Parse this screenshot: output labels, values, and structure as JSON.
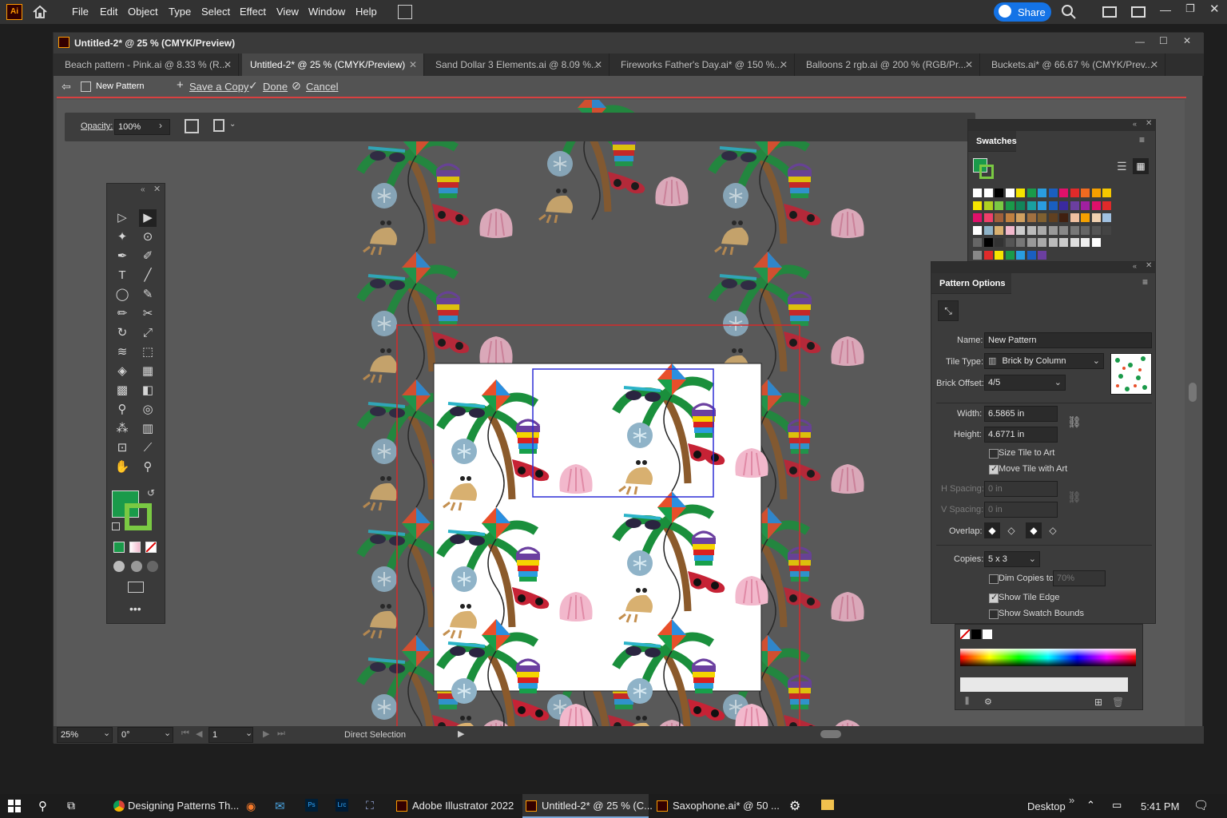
{
  "app": {
    "menu": [
      "File",
      "Edit",
      "Object",
      "Type",
      "Select",
      "Effect",
      "View",
      "Window",
      "Help"
    ],
    "share_label": "Share",
    "colors": {
      "accent": "#1473e6",
      "menubar": "#323232",
      "tile_edge": "#2f2fd6",
      "swatch_bounds": "#d42a2a"
    }
  },
  "document": {
    "title": "Untitled-2* @ 25 % (CMYK/Preview)",
    "tabs": [
      {
        "label": "Beach pattern - Pink.ai @ 8.33 % (R..."
      },
      {
        "label": "Untitled-2* @ 25 % (CMYK/Preview)",
        "active": true
      },
      {
        "label": "Sand Dollar 3 Elements.ai @ 8.09 %..."
      },
      {
        "label": "Fireworks Father's Day.ai* @ 150 %..."
      },
      {
        "label": "Balloons 2 rgb.ai @ 200 % (RGB/Pr..."
      },
      {
        "label": "Buckets.ai* @ 66.67 % (CMYK/Prev..."
      }
    ]
  },
  "pattern_bar": {
    "name": "New Pattern",
    "save_copy": "Save a Copy",
    "done": "Done",
    "cancel": "Cancel"
  },
  "control_bar": {
    "opacity_label": "Opacity:",
    "opacity_value": "100%"
  },
  "status_bar": {
    "zoom": "25%",
    "rotation": "0°",
    "artboard": "1",
    "tool": "Direct Selection"
  },
  "swatches_panel": {
    "title": "Swatches"
  },
  "pattern_options": {
    "title": "Pattern Options",
    "name_label": "Name:",
    "name_value": "New Pattern",
    "tile_type_label": "Tile Type:",
    "tile_type_value": "Brick by Column",
    "brick_offset_label": "Brick Offset:",
    "brick_offset_value": "4/5",
    "width_label": "Width:",
    "width_value": "6.5865 in",
    "height_label": "Height:",
    "height_value": "4.6771 in",
    "size_tile_to_art": "Size Tile to Art",
    "move_tile_with_art": "Move Tile with Art",
    "h_spacing_label": "H Spacing:",
    "h_spacing_value": "0 in",
    "v_spacing_label": "V Spacing:",
    "v_spacing_value": "0 in",
    "overlap_label": "Overlap:",
    "copies_label": "Copies:",
    "copies_value": "5 x 3",
    "dim_copies_label": "Dim Copies to:",
    "dim_copies_value": "70%",
    "show_tile_edge": "Show Tile Edge",
    "show_swatch_bounds": "Show Swatch Bounds",
    "checked": {
      "size_tile_to_art": false,
      "move_tile_with_art": true,
      "dim_copies": false,
      "show_tile_edge": true,
      "show_swatch_bounds": false
    }
  },
  "taskbar": {
    "items": [
      "Designing Patterns Th...",
      "Adobe Illustrator 2022",
      "Untitled-2* @ 25 % (C...",
      "Saxophone.ai* @ 50 ..."
    ],
    "desktop": "Desktop",
    "time": "5:41 PM"
  }
}
